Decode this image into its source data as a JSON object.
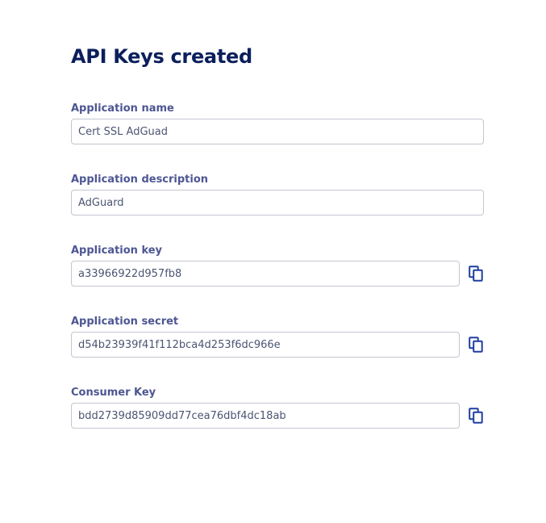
{
  "page": {
    "title": "API Keys created"
  },
  "fields": {
    "app_name": {
      "label": "Application name",
      "value": "Cert SSL AdGuad"
    },
    "app_description": {
      "label": "Application description",
      "value": "AdGuard"
    },
    "app_key": {
      "label": "Application key",
      "value": "a33966922d957fb8"
    },
    "app_secret": {
      "label": "Application secret",
      "value": "d54b23939f41f112bca4d253f6dc966e"
    },
    "consumer_key": {
      "label": "Consumer Key",
      "value": "bdd2739d85909dd77cea76dbf4dc18ab"
    }
  },
  "icons": {
    "copy": "copy-icon"
  },
  "colors": {
    "title": "#0b1f5c",
    "label": "#4d5693",
    "input_text": "#4c5573",
    "input_border": "#c3c6cf",
    "icon": "#1f3fa0"
  }
}
